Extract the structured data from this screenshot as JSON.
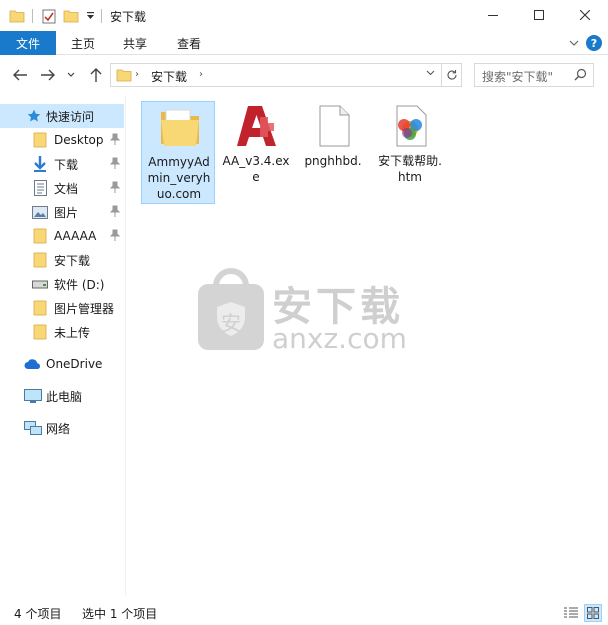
{
  "window": {
    "title": "安下载",
    "minimize_glyph": "—",
    "maximize_glyph": "☐",
    "close_glyph": "✕"
  },
  "ribbon": {
    "tabs": [
      {
        "label": "文件",
        "active": true
      },
      {
        "label": "主页"
      },
      {
        "label": "共享"
      },
      {
        "label": "查看"
      }
    ],
    "collapse_glyph": "⌄",
    "help_glyph": "?"
  },
  "nav": {
    "back_glyph": "←",
    "forward_glyph": "→",
    "recent_glyph": "⌄",
    "up_glyph": "↑"
  },
  "address": {
    "path": "安下载",
    "chevron": "›",
    "dropdown_glyph": "∨",
    "refresh_glyph": "↻"
  },
  "search": {
    "placeholder": "搜索\"安下载\""
  },
  "sidebar": {
    "items": [
      {
        "label": "快速访问",
        "icon": "star-icon",
        "selected": true
      },
      {
        "label": "Desktop",
        "icon": "folder-icon",
        "pinned": true
      },
      {
        "label": "下载",
        "icon": "download-icon",
        "pinned": true
      },
      {
        "label": "文档",
        "icon": "document-icon",
        "pinned": true
      },
      {
        "label": "图片",
        "icon": "picture-icon",
        "pinned": true
      },
      {
        "label": "AAAAA",
        "icon": "folder-icon",
        "pinned": true
      },
      {
        "label": "安下载",
        "icon": "folder-icon"
      },
      {
        "label": "软件 (D:)",
        "icon": "drive-icon"
      },
      {
        "label": "图片管理器",
        "icon": "folder-icon"
      },
      {
        "label": "未上传",
        "icon": "folder-icon"
      },
      {
        "label": "OneDrive",
        "icon": "cloud-icon"
      },
      {
        "label": "此电脑",
        "icon": "computer-icon"
      },
      {
        "label": "网络",
        "icon": "network-icon"
      }
    ]
  },
  "files": [
    {
      "name": "AmmyyAdmin_veryhuo.com",
      "icon": "folder-icon",
      "selected": true
    },
    {
      "name": "AA_v3.4.exe",
      "icon": "ammyy-app-icon"
    },
    {
      "name": "pnghhbd.",
      "icon": "blank-file-icon"
    },
    {
      "name": "安下载帮助.htm",
      "icon": "htm-file-icon"
    }
  ],
  "watermark": {
    "shield_char": "安",
    "text": "安下载",
    "subtext": "anxz.com"
  },
  "status": {
    "item_count": "4 个项目",
    "selection": "选中 1 个项目"
  },
  "colors": {
    "accent": "#1979ca",
    "selection": "#cce8ff",
    "selection_border": "#99d1ff",
    "folder": "#f8d775"
  }
}
